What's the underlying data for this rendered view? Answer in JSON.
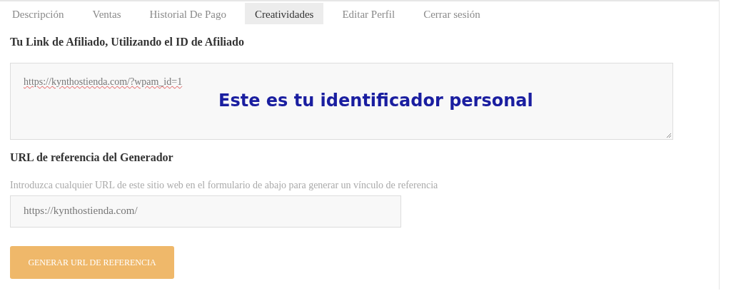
{
  "tabs": [
    {
      "label": "Descripción",
      "selected": false
    },
    {
      "label": "Ventas",
      "selected": false
    },
    {
      "label": "Historial De Pago",
      "selected": false
    },
    {
      "label": "Creatividades",
      "selected": true
    },
    {
      "label": "Editar Perfil",
      "selected": false
    },
    {
      "label": "Cerrar sesión",
      "selected": false
    }
  ],
  "affiliate_link": {
    "heading": "Tu Link de Afiliado, Utilizando el ID de Afiliado",
    "value": "https://kynthostienda.com/?wpam_id=1",
    "annotation": "Este es tu identificador personal"
  },
  "generator": {
    "heading": "URL de referencia del Generador",
    "hint": "Introduzca cualquier URL de este sitio web en el formulario de abajo para generar un vínculo de referencia",
    "value": "https://kynthostienda.com/",
    "button": "GENERAR URL DE REFERENCIA"
  }
}
